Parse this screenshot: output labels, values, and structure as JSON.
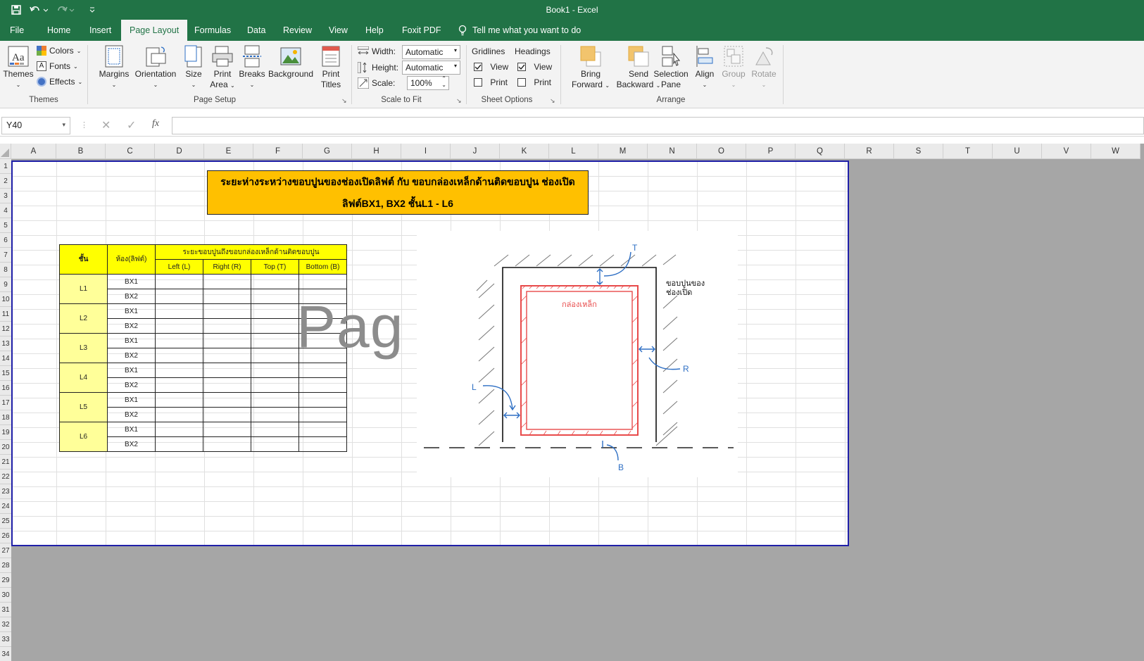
{
  "titlebar": {
    "title": "Book1  -  Excel"
  },
  "tabs": [
    "File",
    "Home",
    "Insert",
    "Page Layout",
    "Formulas",
    "Data",
    "Review",
    "View",
    "Help",
    "Foxit PDF"
  ],
  "active_tab": "Page Layout",
  "tell_me": "Tell me what you want to do",
  "ribbon": {
    "themes": {
      "themes": "Themes",
      "colors": "Colors",
      "fonts": "Fonts",
      "effects": "Effects",
      "group": "Themes"
    },
    "page_setup": {
      "margins": "Margins",
      "orientation": "Orientation",
      "size": "Size",
      "print_area_1": "Print",
      "print_area_2": "Area",
      "breaks": "Breaks",
      "background": "Background",
      "print_titles_1": "Print",
      "print_titles_2": "Titles",
      "group": "Page Setup"
    },
    "scale": {
      "width_label": "Width:",
      "width_value": "Automatic",
      "height_label": "Height:",
      "height_value": "Automatic",
      "scale_label": "Scale:",
      "scale_value": "100%",
      "group": "Scale to Fit"
    },
    "sheet_options": {
      "gridlines": "Gridlines",
      "headings": "Headings",
      "view": "View",
      "print": "Print",
      "group": "Sheet Options"
    },
    "arrange": {
      "bring_1": "Bring",
      "bring_2": "Forward",
      "send_1": "Send",
      "send_2": "Backward",
      "sel_1": "Selection",
      "sel_2": "Pane",
      "align": "Align",
      "group_btn": "Group",
      "rotate": "Rotate",
      "group": "Arrange"
    }
  },
  "name_box": "Y40",
  "columns": [
    "A",
    "B",
    "C",
    "D",
    "E",
    "F",
    "G",
    "H",
    "I",
    "J",
    "K",
    "L",
    "M",
    "N",
    "O",
    "P",
    "Q",
    "R",
    "S",
    "T",
    "U",
    "V",
    "W"
  ],
  "rows": [
    "1",
    "2",
    "3",
    "4",
    "5",
    "6",
    "7",
    "8",
    "9",
    "10",
    "11",
    "12",
    "13",
    "14",
    "15",
    "16",
    "17",
    "18",
    "19",
    "20",
    "21",
    "22",
    "23",
    "24",
    "25",
    "26",
    "27",
    "28",
    "29",
    "30",
    "31",
    "32",
    "33",
    "34"
  ],
  "sheet": {
    "title_line1": "ระยะห่างระหว่างขอบปูนของช่องเปิดลิฟต์ กับ ขอบกล่องเหล็กด้านติดขอบปูน ช่องเปิด",
    "title_line2": "ลิฟต์BX1, BX2 ชั้นL1 - L6",
    "table": {
      "h_floor": "ชั้น",
      "h_room": "ห้อง(ลิฟต์)",
      "h_span": "ระยะขอบปูนถึงขอบกล่องเหล็กด้านติดขอบปูน",
      "h_left": "Left (L)",
      "h_right": "Right (R)",
      "h_top": "Top (T)",
      "h_bottom": "Bottom (B)",
      "floors": [
        "L1",
        "L2",
        "L3",
        "L4",
        "L5",
        "L6"
      ],
      "rooms": [
        "BX1",
        "BX2"
      ]
    },
    "watermark": "Pag",
    "diagram": {
      "label_t": "T",
      "label_r": "R",
      "label_l": "L",
      "label_b": "B",
      "label_box": "กล่องเหล็ก",
      "label_edge_1": "ขอบปูนของ",
      "label_edge_2": "ช่องเปิด"
    }
  },
  "colors": {
    "excel_green": "#217346",
    "title_fill": "#ffc000",
    "header_fill": "#ffff00",
    "floor_fill": "#ffff99",
    "page_border": "#1f1fa8",
    "steel_box": "#e84a4a",
    "dimension": "#2e6fc4"
  }
}
